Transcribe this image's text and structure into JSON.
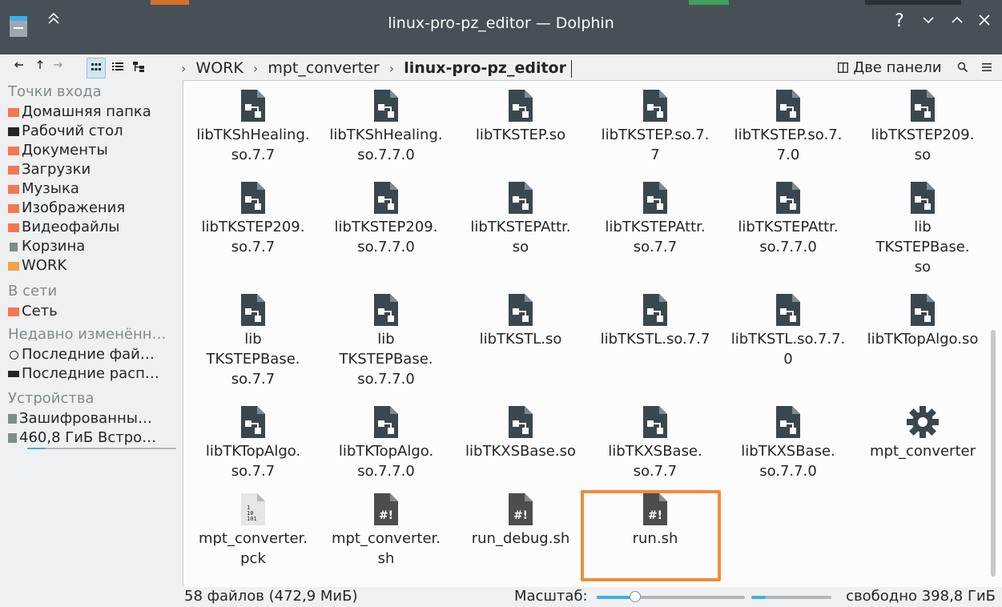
{
  "window": {
    "title": "linux-pro-pz_editor — Dolphin"
  },
  "titlebar": {
    "help": "?",
    "minimize": "⌄",
    "maximize": "⌃",
    "close": "✕",
    "keep_above": "⌃"
  },
  "toolbar": {
    "back": "←",
    "forward": "→",
    "up": "↑",
    "breadcrumb": [
      "WORK",
      "mpt_converter",
      "linux-pro-pz_editor"
    ],
    "split_label": "Две панели",
    "search": "⌕",
    "menu": "≡"
  },
  "sidebar": {
    "sections": [
      {
        "title": "Точки входа"
      },
      {
        "title": "В сети"
      },
      {
        "title": "Недавно изменённ…"
      },
      {
        "title": "Устройства"
      }
    ],
    "items": [
      {
        "label": "Домашняя папка"
      },
      {
        "label": "Рабочий стол"
      },
      {
        "label": "Документы"
      },
      {
        "label": "Загрузки"
      },
      {
        "label": "Музыка"
      },
      {
        "label": "Изображения"
      },
      {
        "label": "Видеофайлы"
      },
      {
        "label": "Корзина"
      },
      {
        "label": "WORK"
      },
      {
        "label": "Сеть"
      },
      {
        "label": "Последние фай…"
      },
      {
        "label": "Последние расп…"
      },
      {
        "label": "Зашифрованны…"
      },
      {
        "label": "460,8 ГиБ Встро…"
      }
    ]
  },
  "files": [
    {
      "l1": "libTKShHealing.",
      "l2": "so.7.7",
      "l3": ""
    },
    {
      "l1": "libTKShHealing.",
      "l2": "so.7.7.0",
      "l3": ""
    },
    {
      "l1": "libTKSTEP.so",
      "l2": "",
      "l3": ""
    },
    {
      "l1": "libTKSTEP.so.7.",
      "l2": "7",
      "l3": ""
    },
    {
      "l1": "libTKSTEP.so.7.",
      "l2": "7.0",
      "l3": ""
    },
    {
      "l1": "libTKSTEP209.",
      "l2": "so",
      "l3": ""
    },
    {
      "l1": "libTKSTEP209.",
      "l2": "so.7.7",
      "l3": ""
    },
    {
      "l1": "libTKSTEP209.",
      "l2": "so.7.7.0",
      "l3": ""
    },
    {
      "l1": "libTKSTEPAttr.",
      "l2": "so",
      "l3": ""
    },
    {
      "l1": "libTKSTEPAttr.",
      "l2": "so.7.7",
      "l3": ""
    },
    {
      "l1": "libTKSTEPAttr.",
      "l2": "so.7.7.0",
      "l3": ""
    },
    {
      "l1": "lib",
      "l2": "TKSTEPBase.",
      "l3": "so"
    },
    {
      "l1": "lib",
      "l2": "TKSTEPBase.",
      "l3": "so.7.7"
    },
    {
      "l1": "lib",
      "l2": "TKSTEPBase.",
      "l3": "so.7.7.0"
    },
    {
      "l1": "libTKSTL.so",
      "l2": "",
      "l3": ""
    },
    {
      "l1": "libTKSTL.so.7.7",
      "l2": "",
      "l3": ""
    },
    {
      "l1": "libTKSTL.so.7.7.",
      "l2": "0",
      "l3": ""
    },
    {
      "l1": "libTKTopAlgo.so",
      "l2": "",
      "l3": ""
    },
    {
      "l1": "libTKTopAlgo.",
      "l2": "so.7.7",
      "l3": ""
    },
    {
      "l1": "libTKTopAlgo.",
      "l2": "so.7.7.0",
      "l3": ""
    },
    {
      "l1": "libTKXSBase.so",
      "l2": "",
      "l3": ""
    },
    {
      "l1": "libTKXSBase.",
      "l2": "so.7.7",
      "l3": ""
    },
    {
      "l1": "libTKXSBase.",
      "l2": "so.7.7.0",
      "l3": ""
    },
    {
      "l1": "mpt_converter",
      "l2": "",
      "l3": ""
    },
    {
      "l1": "mpt_converter.",
      "l2": "pck",
      "l3": ""
    },
    {
      "l1": "mpt_converter.",
      "l2": "sh",
      "l3": ""
    },
    {
      "l1": "run_debug.sh",
      "l2": "",
      "l3": ""
    },
    {
      "l1": "run.sh",
      "l2": "",
      "l3": ""
    }
  ],
  "icon_glyphs": {
    "script": "#!",
    "binary": "1 10 101"
  },
  "status": {
    "summary": "58 файлов (472,9 МиБ)",
    "zoom_label": "Масштаб:",
    "free": "свободно 398,8 ГиБ"
  },
  "colors": {
    "titlebar": "#475057",
    "folder": "#f47750",
    "file_icon": "#3b474f",
    "selection": "#f28c38",
    "slider": "#3daee9"
  }
}
